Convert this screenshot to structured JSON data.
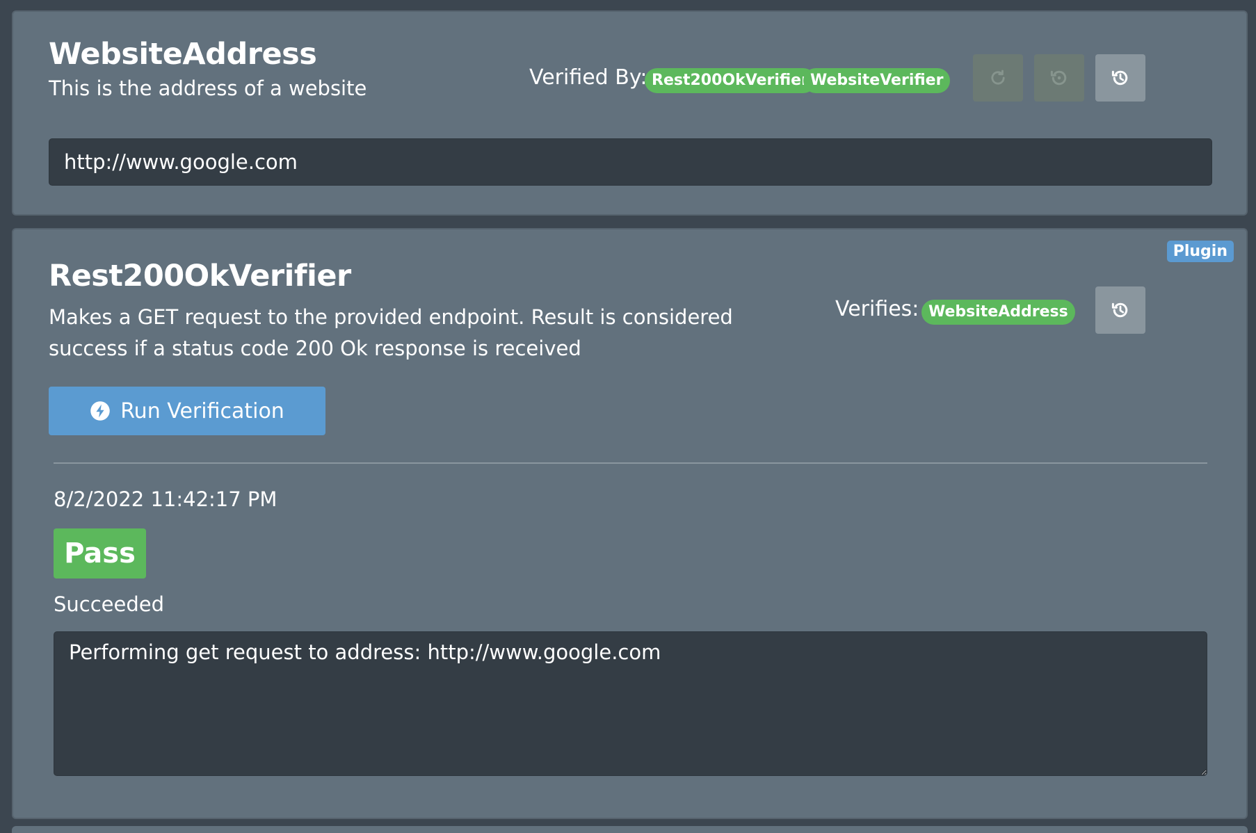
{
  "setting": {
    "title": "WebsiteAddress",
    "description": "This is the address of a website",
    "verified_by_label": "Verified By:",
    "verifiers": [
      "Rest200OkVerifier",
      "WebsiteVerifier"
    ],
    "value": "http://www.google.com",
    "icons": [
      "reset-icon",
      "restore-icon",
      "history-icon"
    ]
  },
  "verifier": {
    "badge": "Plugin",
    "title": "Rest200OkVerifier",
    "description": "Makes a GET request to the provided endpoint. Result is considered success if a status code 200 Ok response is received",
    "verifies_label": "Verifies:",
    "verifies": [
      "WebsiteAddress"
    ],
    "run_label": "Run Verification",
    "result": {
      "timestamp": "8/2/2022 11:42:17 PM",
      "status": "Pass",
      "message": "Succeeded",
      "log": "Performing get request to address: http://www.google.com"
    }
  },
  "colors": {
    "page_bg": "#3c4650",
    "card_bg": "#62717d",
    "success": "#5cb85c",
    "primary": "#5b9bd1",
    "input_bg": "#343d45"
  }
}
